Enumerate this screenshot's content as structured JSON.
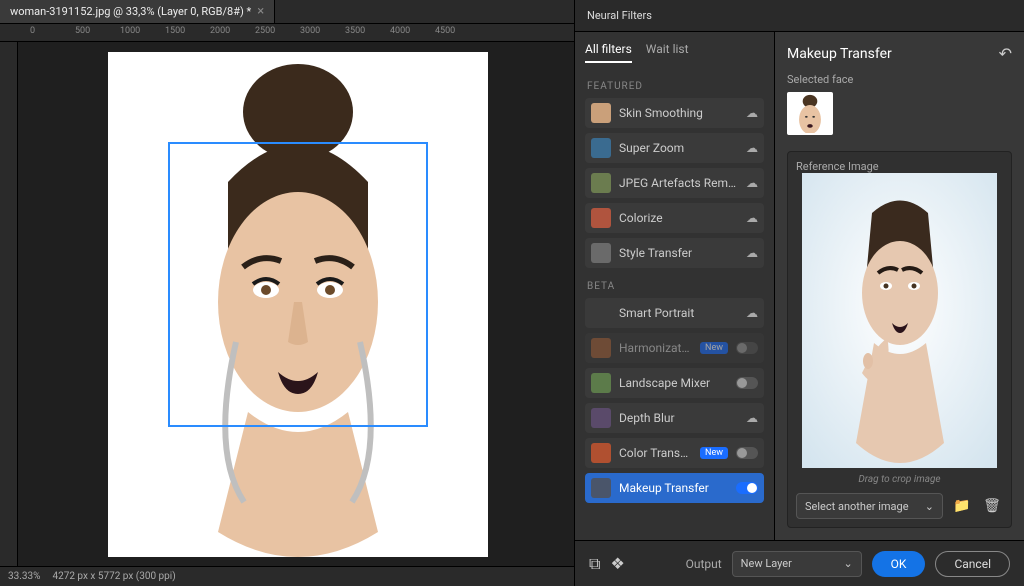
{
  "document": {
    "tab_title": "woman-3191152.jpg @ 33,3% (Layer 0, RGB/8#) *",
    "zoom": "33.33%",
    "info": "4272 px x 5772 px (300 ppi)"
  },
  "ruler_ticks_h": [
    "0",
    "500",
    "1000",
    "1500",
    "2000",
    "2500",
    "3000",
    "3500",
    "4000",
    "4500"
  ],
  "panel_title": "Neural Filters",
  "tabs": {
    "all": "All filters",
    "wait": "Wait list"
  },
  "sections": {
    "featured": "Featured",
    "beta": "Beta"
  },
  "filters": {
    "featured": [
      {
        "name": "Skin Smoothing",
        "indicator": "cloud",
        "icon_bg": "#caa07a"
      },
      {
        "name": "Super Zoom",
        "indicator": "cloud",
        "icon_bg": "#3a6b90"
      },
      {
        "name": "JPEG Artefacts Removal",
        "indicator": "cloud",
        "icon_bg": "#6b7c4f"
      },
      {
        "name": "Colorize",
        "indicator": "cloud",
        "icon_bg": "#b0543e"
      },
      {
        "name": "Style Transfer",
        "indicator": "cloud",
        "icon_bg": "#6a6a6a"
      }
    ],
    "beta": [
      {
        "name": "Smart Portrait",
        "indicator": "cloud",
        "icon_bg": "#3a3a3a"
      },
      {
        "name": "Harmonization",
        "indicator": "toggle_off",
        "badge": "New",
        "disabled": true,
        "icon_bg": "#a0603a"
      },
      {
        "name": "Landscape Mixer",
        "indicator": "toggle_off",
        "icon_bg": "#5c7b4a"
      },
      {
        "name": "Depth Blur",
        "indicator": "cloud",
        "icon_bg": "#5a4a6a"
      },
      {
        "name": "Color Transfer",
        "indicator": "toggle_off",
        "badge": "New",
        "icon_bg": "#b05030"
      },
      {
        "name": "Makeup Transfer",
        "indicator": "toggle_on",
        "selected": true,
        "icon_bg": "#4a556a"
      }
    ]
  },
  "badge_new_label": "New",
  "details": {
    "title": "Makeup Transfer",
    "selected_face_label": "Selected face",
    "reference_label": "Reference Image",
    "drag_hint": "Drag to crop image",
    "select_placeholder": "Select another image"
  },
  "output": {
    "label": "Output",
    "value": "New Layer"
  },
  "buttons": {
    "ok": "OK",
    "cancel": "Cancel"
  },
  "colors": {
    "accent": "#1473e6",
    "selection_box": "#2a8cff"
  }
}
